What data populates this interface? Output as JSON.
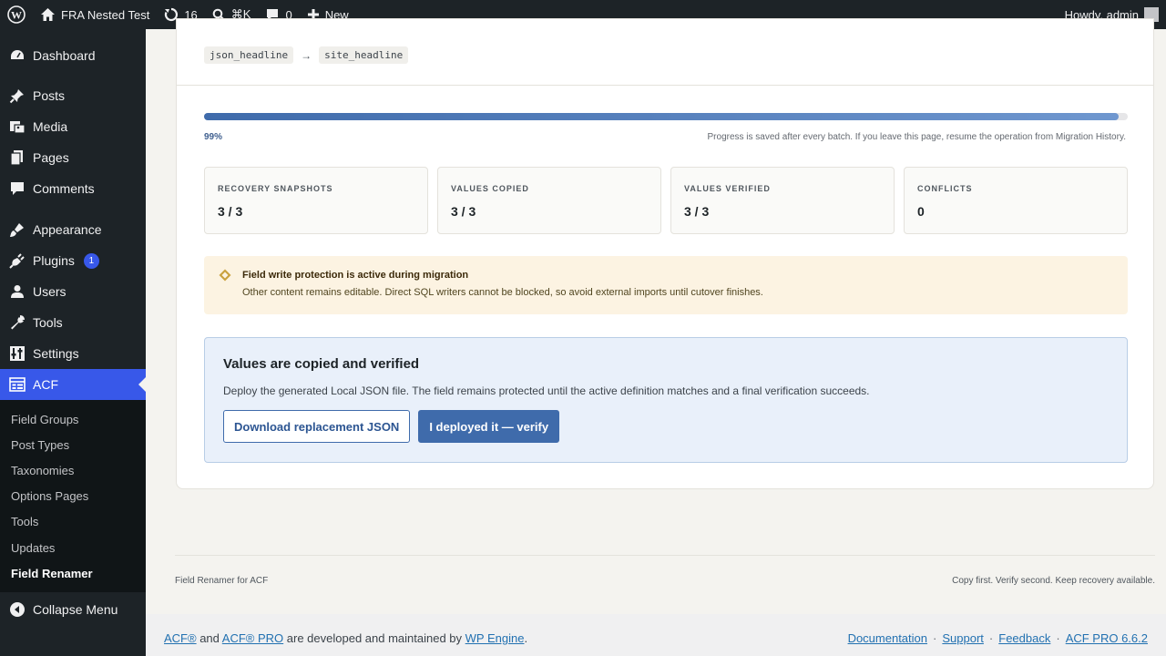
{
  "adminbar": {
    "site_name": "FRA Nested Test",
    "updates_count": "16",
    "search_shortcut": "⌘K",
    "comments_count": "0",
    "new_label": "New",
    "howdy": "Howdy, admin"
  },
  "sidebar": {
    "items": [
      {
        "label": "Dashboard"
      },
      {
        "label": "Posts"
      },
      {
        "label": "Media"
      },
      {
        "label": "Pages"
      },
      {
        "label": "Comments"
      },
      {
        "label": "Appearance"
      },
      {
        "label": "Plugins",
        "badge": "1"
      },
      {
        "label": "Users"
      },
      {
        "label": "Tools"
      },
      {
        "label": "Settings"
      },
      {
        "label": "ACF"
      }
    ],
    "submenu": [
      {
        "label": "Field Groups"
      },
      {
        "label": "Post Types"
      },
      {
        "label": "Taxonomies"
      },
      {
        "label": "Options Pages"
      },
      {
        "label": "Tools"
      },
      {
        "label": "Updates"
      },
      {
        "label": "Field Renamer"
      }
    ],
    "collapse_label": "Collapse Menu"
  },
  "main": {
    "chips": {
      "from": "json_headline",
      "arrow": "→",
      "to": "site_headline"
    },
    "progress": {
      "percent": 99,
      "percent_label": "99%",
      "note": "Progress is saved after every batch. If you leave this page, resume the operation from Migration History."
    },
    "stats": [
      {
        "label": "RECOVERY SNAPSHOTS",
        "value": "3 / 3"
      },
      {
        "label": "VALUES COPIED",
        "value": "3 / 3"
      },
      {
        "label": "VALUES VERIFIED",
        "value": "3 / 3"
      },
      {
        "label": "CONFLICTS",
        "value": "0"
      }
    ],
    "notice": {
      "title": "Field write protection is active during migration",
      "text": "Other content remains editable. Direct SQL writers cannot be blocked, so avoid external imports until cutover finishes."
    },
    "panel": {
      "title": "Values are copied and verified",
      "text": "Deploy the generated Local JSON file. The field remains protected until the active definition matches and a final verification succeeds.",
      "download_label": "Download replacement JSON",
      "verify_label": "I deployed it — verify"
    }
  },
  "plugin_footer": {
    "left": "Field Renamer for ACF",
    "right": "Copy first. Verify second. Keep recovery available."
  },
  "acf_footer": {
    "acf": "ACF®",
    "and": " and ",
    "acf_pro": "ACF® PRO",
    "maintained": " are developed and maintained by ",
    "wp_engine": "WP Engine",
    "period": ".",
    "documentation": "Documentation",
    "support": "Support",
    "feedback": "Feedback",
    "version": "ACF PRO 6.6.2",
    "separator": "·"
  },
  "colors": {
    "accent": "#3858e9",
    "primary_button": "#3f6bab",
    "notice_bg": "#fcf3e2",
    "panel_bg": "#e9f0fa"
  }
}
